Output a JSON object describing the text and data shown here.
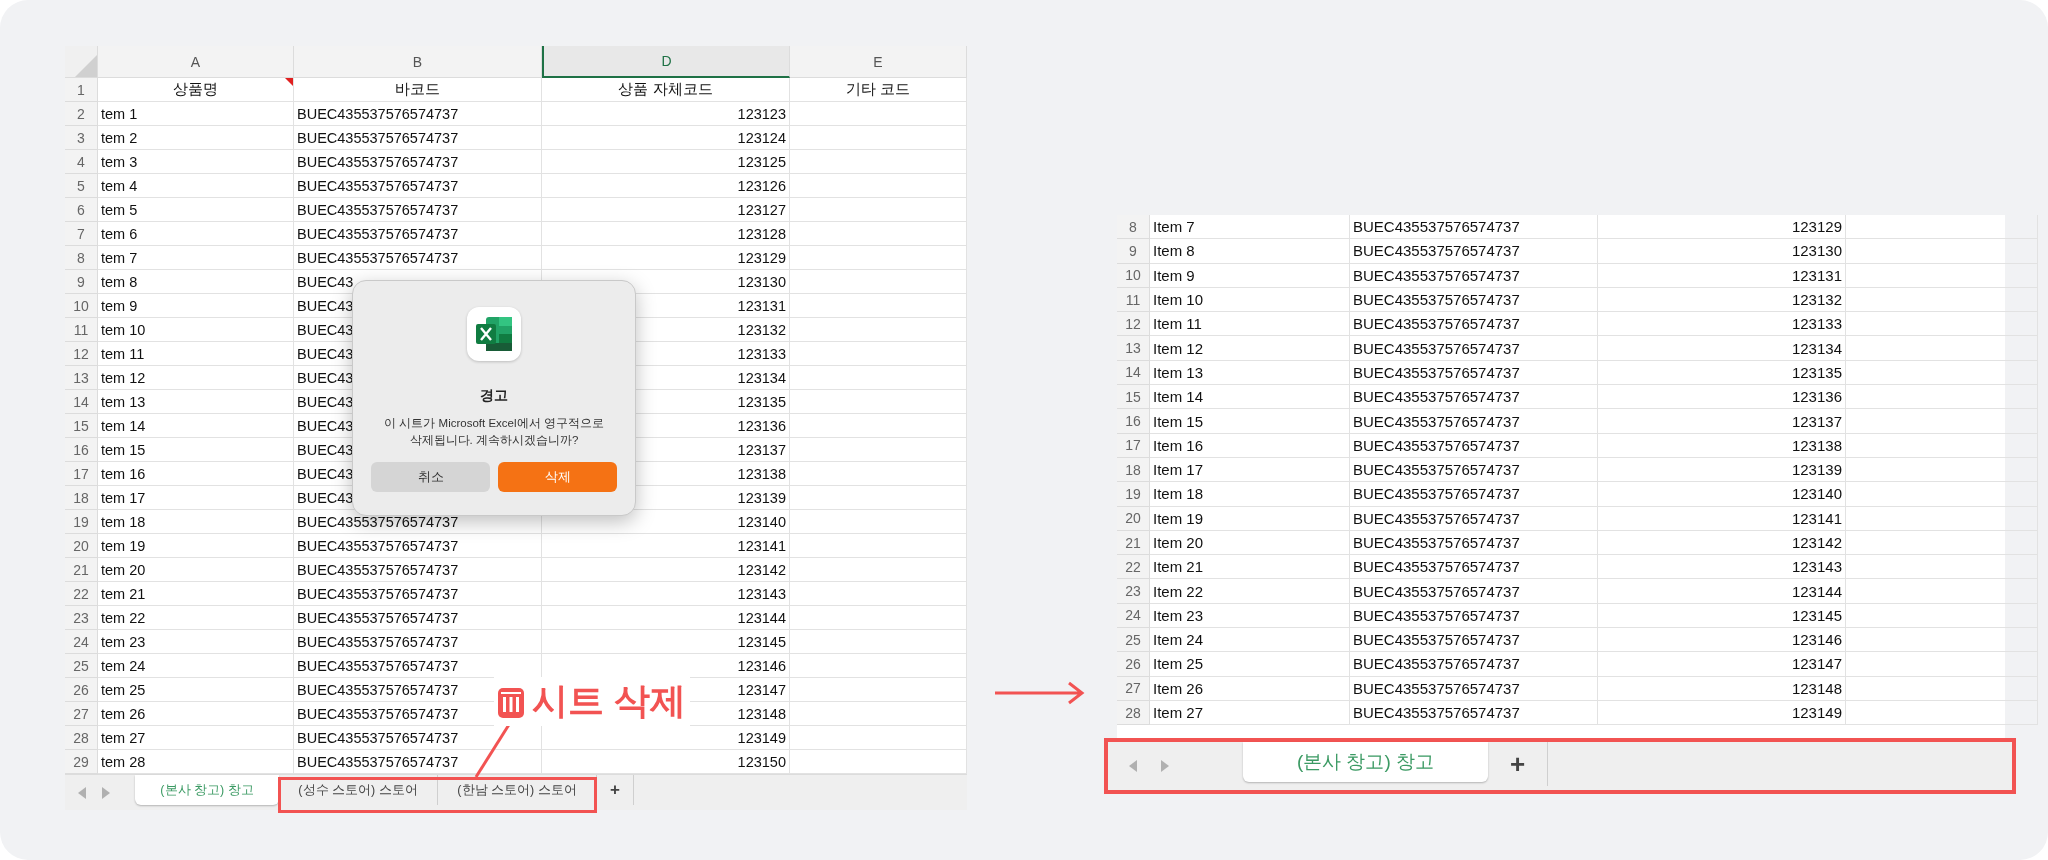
{
  "left_sheet": {
    "columns": [
      {
        "letter": "A",
        "selected": false
      },
      {
        "letter": "B",
        "selected": false
      },
      {
        "letter": "D",
        "selected": true
      },
      {
        "letter": "E",
        "selected": false
      }
    ],
    "header_row": {
      "number": "1",
      "cells": [
        {
          "text": "상품명",
          "comment": true
        },
        {
          "text": "바코드",
          "comment": false
        },
        {
          "text": "상품 자체코드",
          "comment": false
        },
        {
          "text": "기타 코드",
          "comment": false
        }
      ]
    },
    "rows": [
      {
        "number": "2",
        "item": "tem 1",
        "barcode": "BUEC435537576574737",
        "code": "123123"
      },
      {
        "number": "3",
        "item": "tem 2",
        "barcode": "BUEC435537576574737",
        "code": "123124"
      },
      {
        "number": "4",
        "item": "tem 3",
        "barcode": "BUEC435537576574737",
        "code": "123125"
      },
      {
        "number": "5",
        "item": "tem 4",
        "barcode": "BUEC435537576574737",
        "code": "123126"
      },
      {
        "number": "6",
        "item": "tem 5",
        "barcode": "BUEC435537576574737",
        "code": "123127"
      },
      {
        "number": "7",
        "item": "tem 6",
        "barcode": "BUEC435537576574737",
        "code": "123128"
      },
      {
        "number": "8",
        "item": "tem 7",
        "barcode": "BUEC435537576574737",
        "code": "123129"
      },
      {
        "number": "9",
        "item": "tem 8",
        "barcode": "BUEC43",
        "code": "123130"
      },
      {
        "number": "10",
        "item": "tem 9",
        "barcode": "BUEC43",
        "code": "123131"
      },
      {
        "number": "11",
        "item": "tem 10",
        "barcode": "BUEC43",
        "code": "123132"
      },
      {
        "number": "12",
        "item": "tem 11",
        "barcode": "BUEC43",
        "code": "123133"
      },
      {
        "number": "13",
        "item": "tem 12",
        "barcode": "BUEC43",
        "code": "123134"
      },
      {
        "number": "14",
        "item": "tem 13",
        "barcode": "BUEC43",
        "code": "123135"
      },
      {
        "number": "15",
        "item": "tem 14",
        "barcode": "BUEC43",
        "code": "123136"
      },
      {
        "number": "16",
        "item": "tem 15",
        "barcode": "BUEC43",
        "code": "123137"
      },
      {
        "number": "17",
        "item": "tem 16",
        "barcode": "BUEC43",
        "code": "123138"
      },
      {
        "number": "18",
        "item": "tem 17",
        "barcode": "BUEC43",
        "code": "123139"
      },
      {
        "number": "19",
        "item": "tem 18",
        "barcode": "BUEC435537576574737",
        "code": "123140"
      },
      {
        "number": "20",
        "item": "tem 19",
        "barcode": "BUEC435537576574737",
        "code": "123141"
      },
      {
        "number": "21",
        "item": "tem 20",
        "barcode": "BUEC435537576574737",
        "code": "123142"
      },
      {
        "number": "22",
        "item": "tem 21",
        "barcode": "BUEC435537576574737",
        "code": "123143"
      },
      {
        "number": "23",
        "item": "tem 22",
        "barcode": "BUEC435537576574737",
        "code": "123144"
      },
      {
        "number": "24",
        "item": "tem 23",
        "barcode": "BUEC435537576574737",
        "code": "123145"
      },
      {
        "number": "25",
        "item": "tem 24",
        "barcode": "BUEC435537576574737",
        "code": "123146"
      },
      {
        "number": "26",
        "item": "tem 25",
        "barcode": "BUEC435537576574737",
        "code": "123147"
      },
      {
        "number": "27",
        "item": "tem 26",
        "barcode": "BUEC435537576574737",
        "code": "123148"
      },
      {
        "number": "28",
        "item": "tem 27",
        "barcode": "BUEC435537576574737",
        "code": "123149"
      },
      {
        "number": "29",
        "item": "tem 28",
        "barcode": "BUEC435537576574737",
        "code": "123150"
      }
    ],
    "sheet_tabs": [
      {
        "label": "(본사 창고) 창고",
        "selected": true
      },
      {
        "label": "(성수 스토어) 스토어",
        "selected": false
      },
      {
        "label": "(한남 스토어) 스토어",
        "selected": false
      }
    ],
    "add_sheet": "+"
  },
  "dialog": {
    "title": "경고",
    "message": "이 시트가 Microsoft Excel에서 영구적으로 삭제됩니다. 계속하시겠습니까?",
    "buttons": [
      {
        "label": "취소",
        "kind": "cancel"
      },
      {
        "label": "삭제",
        "kind": "primary"
      }
    ]
  },
  "callout": {
    "label": "시트 삭제"
  },
  "right_sheet": {
    "rows": [
      {
        "number": "8",
        "item": "Item 7",
        "barcode": "BUEC435537576574737",
        "code": "123129"
      },
      {
        "number": "9",
        "item": "Item 8",
        "barcode": "BUEC435537576574737",
        "code": "123130"
      },
      {
        "number": "10",
        "item": "Item 9",
        "barcode": "BUEC435537576574737",
        "code": "123131"
      },
      {
        "number": "11",
        "item": "Item 10",
        "barcode": "BUEC435537576574737",
        "code": "123132"
      },
      {
        "number": "12",
        "item": "Item 11",
        "barcode": "BUEC435537576574737",
        "code": "123133"
      },
      {
        "number": "13",
        "item": "Item 12",
        "barcode": "BUEC435537576574737",
        "code": "123134"
      },
      {
        "number": "14",
        "item": "Item 13",
        "barcode": "BUEC435537576574737",
        "code": "123135"
      },
      {
        "number": "15",
        "item": "Item 14",
        "barcode": "BUEC435537576574737",
        "code": "123136"
      },
      {
        "number": "16",
        "item": "Item 15",
        "barcode": "BUEC435537576574737",
        "code": "123137"
      },
      {
        "number": "17",
        "item": "Item 16",
        "barcode": "BUEC435537576574737",
        "code": "123138"
      },
      {
        "number": "18",
        "item": "Item 17",
        "barcode": "BUEC435537576574737",
        "code": "123139"
      },
      {
        "number": "19",
        "item": "Item 18",
        "barcode": "BUEC435537576574737",
        "code": "123140"
      },
      {
        "number": "20",
        "item": "Item 19",
        "barcode": "BUEC435537576574737",
        "code": "123141"
      },
      {
        "number": "21",
        "item": "Item 20",
        "barcode": "BUEC435537576574737",
        "code": "123142"
      },
      {
        "number": "22",
        "item": "Item 21",
        "barcode": "BUEC435537576574737",
        "code": "123143"
      },
      {
        "number": "23",
        "item": "Item 22",
        "barcode": "BUEC435537576574737",
        "code": "123144"
      },
      {
        "number": "24",
        "item": "Item 23",
        "barcode": "BUEC435537576574737",
        "code": "123145"
      },
      {
        "number": "25",
        "item": "Item 24",
        "barcode": "BUEC435537576574737",
        "code": "123146"
      },
      {
        "number": "26",
        "item": "Item 25",
        "barcode": "BUEC435537576574737",
        "code": "123147"
      },
      {
        "number": "27",
        "item": "Item 26",
        "barcode": "BUEC435537576574737",
        "code": "123148"
      },
      {
        "number": "28",
        "item": "Item 27",
        "barcode": "BUEC435537576574737",
        "code": "123149"
      }
    ],
    "sheet_tabs": [
      {
        "label": "(본사 창고) 창고",
        "selected": true
      }
    ],
    "add_sheet": "+"
  }
}
